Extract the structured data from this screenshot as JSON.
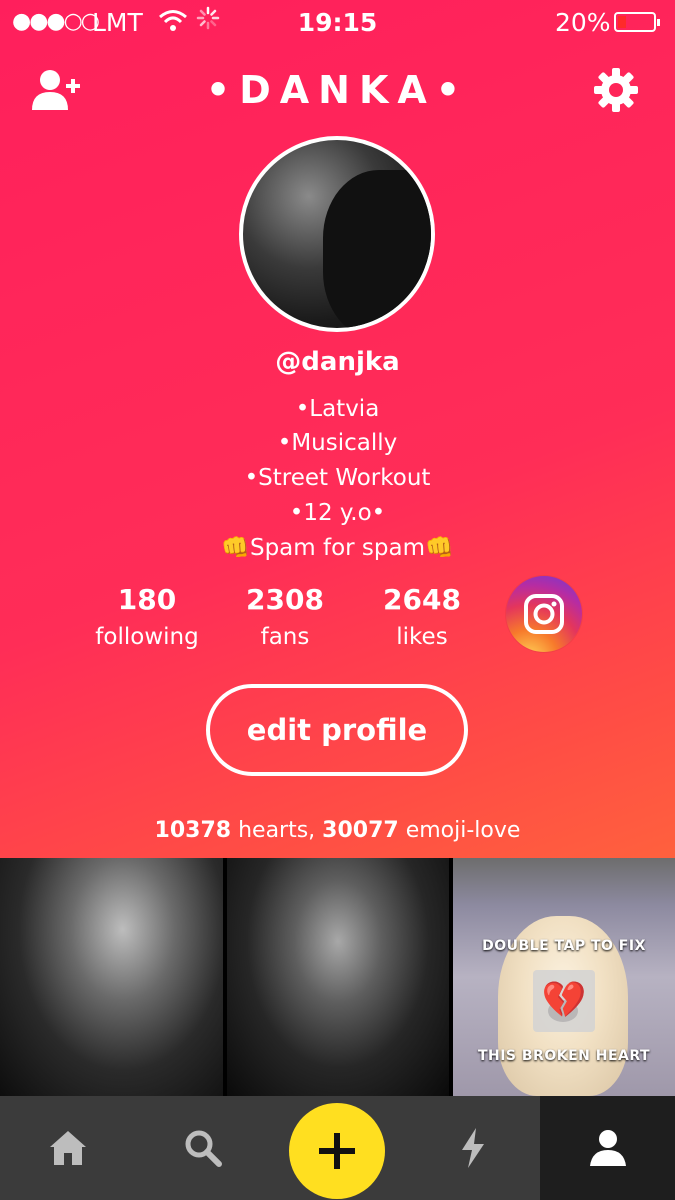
{
  "status_bar": {
    "signal": "●●●○○",
    "carrier": "LMT",
    "time": "19:15",
    "battery": "20%",
    "battery_level": 0.2,
    "icons": [
      "signal-icon",
      "wifi-icon",
      "loading-spinner-icon",
      "battery-icon"
    ]
  },
  "header": {
    "title": "•DANKA•",
    "left_icon": "add-user-icon",
    "right_icon": "gear-icon"
  },
  "profile": {
    "username": "@danjka",
    "bio": [
      "•Latvia",
      "•Musically",
      "•Street Workout",
      "•12 y.o•",
      "👊Spam for spam👊"
    ]
  },
  "stats": [
    {
      "value": "180",
      "label": "following"
    },
    {
      "value": "2308",
      "label": "fans"
    },
    {
      "value": "2648",
      "label": "likes"
    }
  ],
  "instagram_icon": "instagram-icon",
  "edit_profile_label": "edit profile",
  "summary": {
    "hearts": "10378",
    "hearts_label": " hearts, ",
    "emoji_love": "30077",
    "emoji_label": " emoji-love"
  },
  "videos": [
    {
      "kind": "selfie"
    },
    {
      "kind": "selfie"
    },
    {
      "caption_top": "DOUBLE TAP TO FIX",
      "caption_bottom": "THIS BROKEN HEART",
      "icon": "broken-heart-icon"
    }
  ],
  "tabbar": {
    "tabs": [
      "home-icon",
      "search-icon",
      "add-icon",
      "lightning-icon",
      "profile-icon"
    ],
    "active": "profile-icon"
  },
  "colors": {
    "gradient_top": "#ff1f5c",
    "gradient_bottom": "#ff8a2e",
    "add_button": "#ffdf20",
    "tabbar": "#3b3b3b"
  }
}
